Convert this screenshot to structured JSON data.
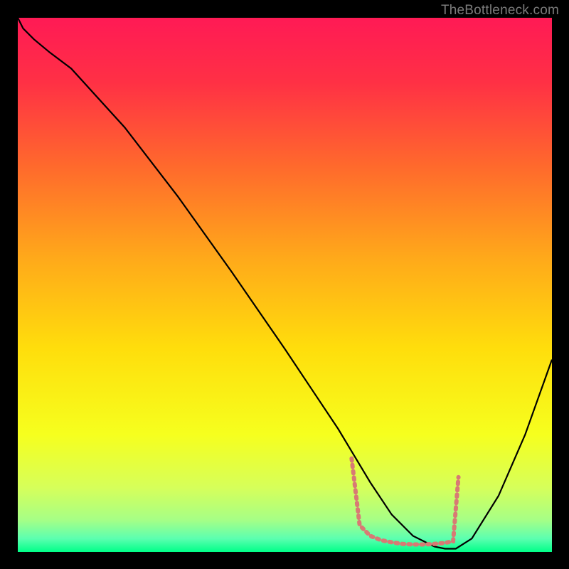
{
  "header": {
    "attribution": "TheBottleneck.com"
  },
  "chart_data": {
    "type": "line",
    "title": "",
    "xlabel": "",
    "ylabel": "",
    "xlim": [
      0,
      100
    ],
    "ylim": [
      0,
      100
    ],
    "background": {
      "type": "vertical-gradient",
      "stops": [
        {
          "pos": 0.0,
          "color": "#ff1a55"
        },
        {
          "pos": 0.12,
          "color": "#ff3045"
        },
        {
          "pos": 0.28,
          "color": "#ff6a2c"
        },
        {
          "pos": 0.45,
          "color": "#ffa91a"
        },
        {
          "pos": 0.62,
          "color": "#ffde0c"
        },
        {
          "pos": 0.78,
          "color": "#f6ff1e"
        },
        {
          "pos": 0.88,
          "color": "#d6ff5a"
        },
        {
          "pos": 0.94,
          "color": "#a6ff86"
        },
        {
          "pos": 0.975,
          "color": "#5cffb0"
        },
        {
          "pos": 1.0,
          "color": "#00ff88"
        }
      ]
    },
    "series": [
      {
        "name": "bottleneck-curve",
        "color": "#000000",
        "width": 2.2,
        "x": [
          0,
          1,
          3,
          6,
          10,
          20,
          30,
          40,
          50,
          55,
          60,
          63,
          66,
          70,
          74,
          78,
          80,
          82,
          85,
          90,
          95,
          100
        ],
        "y": [
          100,
          98,
          96,
          93.5,
          90.5,
          79.5,
          66.5,
          52.5,
          38,
          30.5,
          23,
          18,
          13,
          7,
          3,
          1,
          0.6,
          0.6,
          2.5,
          10.5,
          22,
          36
        ]
      },
      {
        "name": "optimal-range-marker",
        "color": "#d87a74",
        "width": 6,
        "dash": "3 6",
        "x": [
          62.5,
          64,
          66,
          68,
          70,
          72,
          74,
          76,
          78,
          80,
          81.5,
          82.5
        ],
        "y": [
          17.5,
          5,
          3,
          2.2,
          1.8,
          1.5,
          1.4,
          1.4,
          1.5,
          1.7,
          2,
          14
        ]
      }
    ]
  }
}
